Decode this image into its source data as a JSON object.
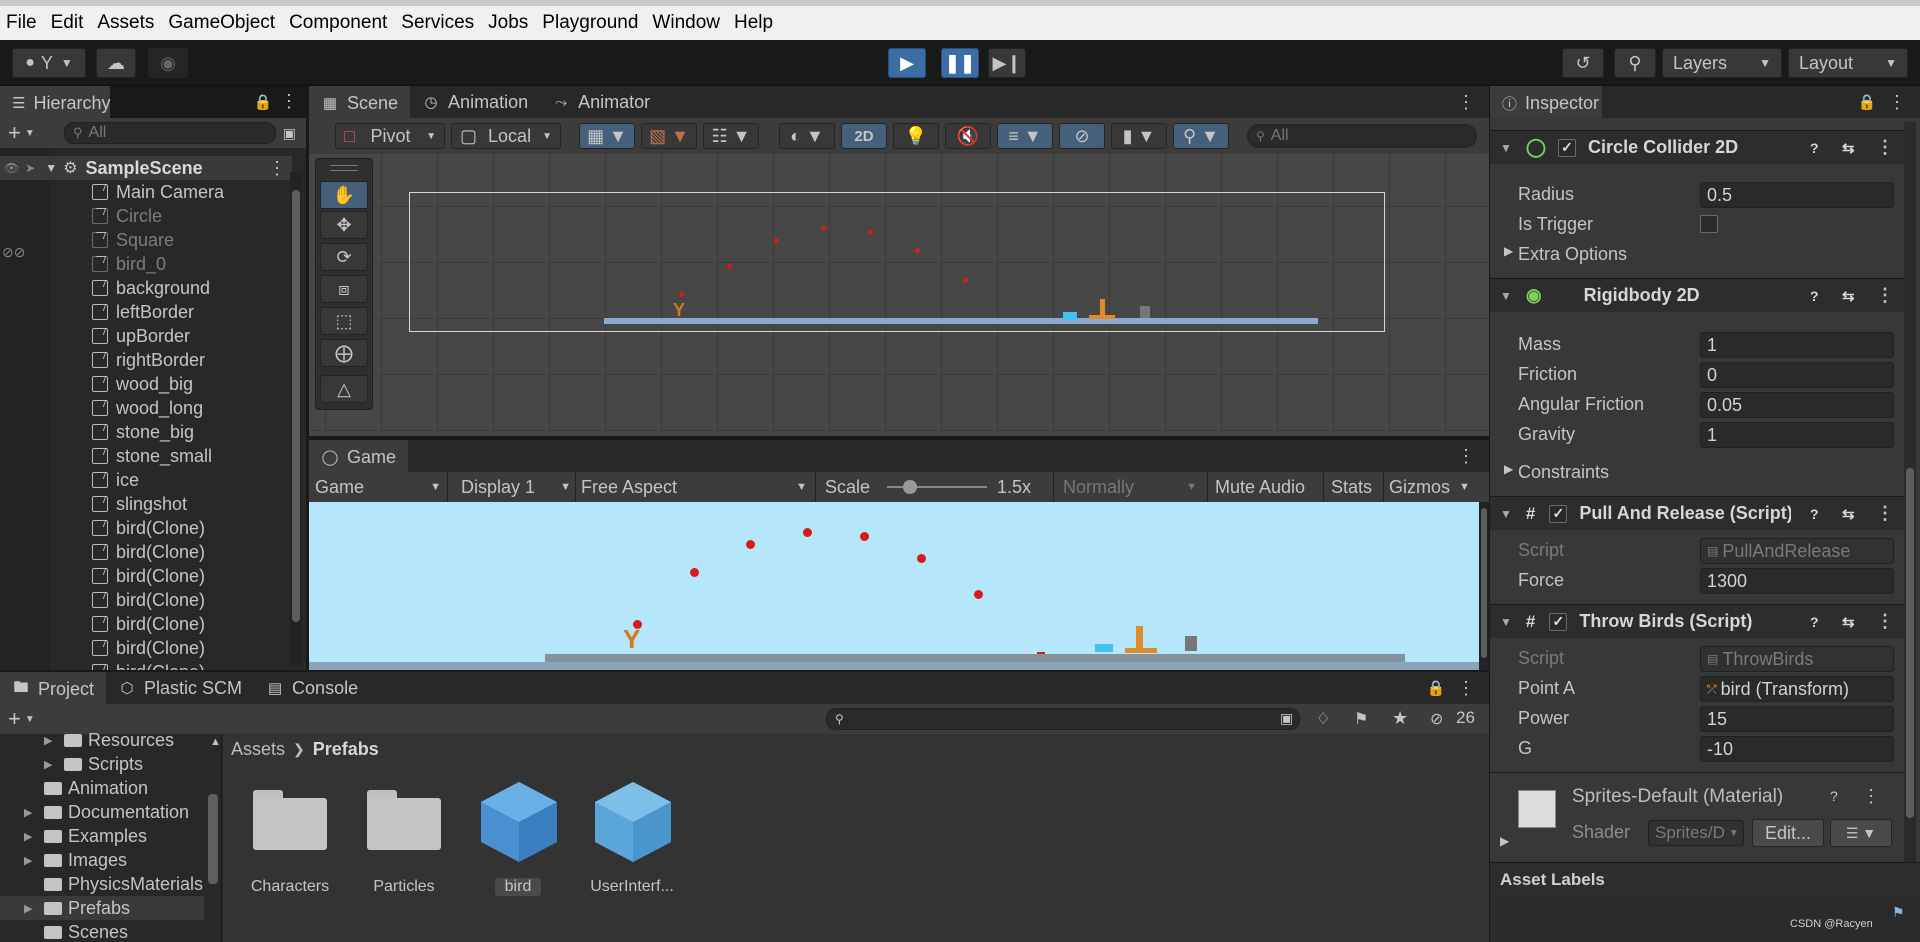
{
  "menu": [
    "File",
    "Edit",
    "Assets",
    "GameObject",
    "Component",
    "Services",
    "Jobs",
    "Playground",
    "Window",
    "Help"
  ],
  "toolbar": {
    "account": "Y",
    "layers": "Layers",
    "layout": "Layout"
  },
  "hierarchy": {
    "tab": "Hierarchy",
    "search_placeholder": "All",
    "scene": "SampleScene",
    "items": [
      {
        "name": "Main Camera",
        "dim": false
      },
      {
        "name": "Circle",
        "dim": true
      },
      {
        "name": "Square",
        "dim": true
      },
      {
        "name": "bird_0",
        "dim": true
      },
      {
        "name": "background",
        "dim": false
      },
      {
        "name": "leftBorder",
        "dim": false
      },
      {
        "name": "upBorder",
        "dim": false
      },
      {
        "name": "rightBorder",
        "dim": false
      },
      {
        "name": "wood_big",
        "dim": false
      },
      {
        "name": "wood_long",
        "dim": false
      },
      {
        "name": "stone_big",
        "dim": false
      },
      {
        "name": "stone_small",
        "dim": false
      },
      {
        "name": "ice",
        "dim": false
      },
      {
        "name": "slingshot",
        "dim": false
      },
      {
        "name": "bird(Clone)",
        "dim": false
      },
      {
        "name": "bird(Clone)",
        "dim": false
      },
      {
        "name": "bird(Clone)",
        "dim": false
      },
      {
        "name": "bird(Clone)",
        "dim": false
      },
      {
        "name": "bird(Clone)",
        "dim": false
      },
      {
        "name": "bird(Clone)",
        "dim": false
      },
      {
        "name": "bird(Clone)",
        "dim": false
      }
    ]
  },
  "scene": {
    "tabs": [
      "Scene",
      "Animation",
      "Animator"
    ],
    "pivot": "Pivot",
    "local": "Local",
    "mode2d": "2D",
    "search_placeholder": "All"
  },
  "game": {
    "tab": "Game",
    "view": "Game",
    "display": "Display 1",
    "aspect": "Free Aspect",
    "scale_label": "Scale",
    "scale_value": "1.5x",
    "normally": "Normally",
    "mute": "Mute Audio",
    "stats": "Stats",
    "gizmos": "Gizmos"
  },
  "project": {
    "tabs": [
      "Project",
      "Plastic SCM",
      "Console"
    ],
    "hidden_count": "26",
    "tree": [
      {
        "name": "Resources",
        "indent": 2,
        "arrow": true
      },
      {
        "name": "Scripts",
        "indent": 2,
        "arrow": true
      },
      {
        "name": "Animation",
        "indent": 1,
        "arrow": false
      },
      {
        "name": "Documentation",
        "indent": 1,
        "arrow": true
      },
      {
        "name": "Examples",
        "indent": 1,
        "arrow": true
      },
      {
        "name": "Images",
        "indent": 1,
        "arrow": true
      },
      {
        "name": "PhysicsMaterials",
        "indent": 1,
        "arrow": false
      },
      {
        "name": "Prefabs",
        "indent": 1,
        "arrow": true
      },
      {
        "name": "Scenes",
        "indent": 1,
        "arrow": false
      }
    ],
    "breadcrumb": {
      "root": "Assets",
      "current": "Prefabs"
    },
    "assets": [
      {
        "name": "Characters",
        "kind": "folder"
      },
      {
        "name": "Particles",
        "kind": "folder"
      },
      {
        "name": "bird",
        "kind": "prefab"
      },
      {
        "name": "UserInterf...",
        "kind": "prefab"
      }
    ]
  },
  "inspector": {
    "tab": "Inspector",
    "circle_collider": {
      "title": "Circle Collider 2D",
      "radius_label": "Radius",
      "radius": "0.5",
      "trigger_label": "Is Trigger",
      "extra": "Extra Options"
    },
    "rigidbody": {
      "title": "Rigidbody 2D",
      "mass_label": "Mass",
      "mass": "1",
      "friction_label": "Friction",
      "friction": "0",
      "angular_label": "Angular Friction",
      "angular": "0.05",
      "gravity_label": "Gravity",
      "gravity": "1",
      "constraints": "Constraints"
    },
    "pull": {
      "title": "Pull And Release (Script)",
      "script_label": "Script",
      "script": "PullAndRelease",
      "force_label": "Force",
      "force": "1300"
    },
    "throw": {
      "title": "Throw Birds (Script)",
      "script_label": "Script",
      "script": "ThrowBirds",
      "pointa_label": "Point A",
      "pointa": "bird (Transform)",
      "power_label": "Power",
      "power": "15",
      "g_label": "G",
      "g": "-10"
    },
    "material": {
      "title": "Sprites-Default (Material)",
      "shader_label": "Shader",
      "shader": "Sprites/D",
      "edit": "Edit..."
    },
    "asset_labels": "Asset Labels"
  },
  "watermark": "CSDN @Racyen"
}
